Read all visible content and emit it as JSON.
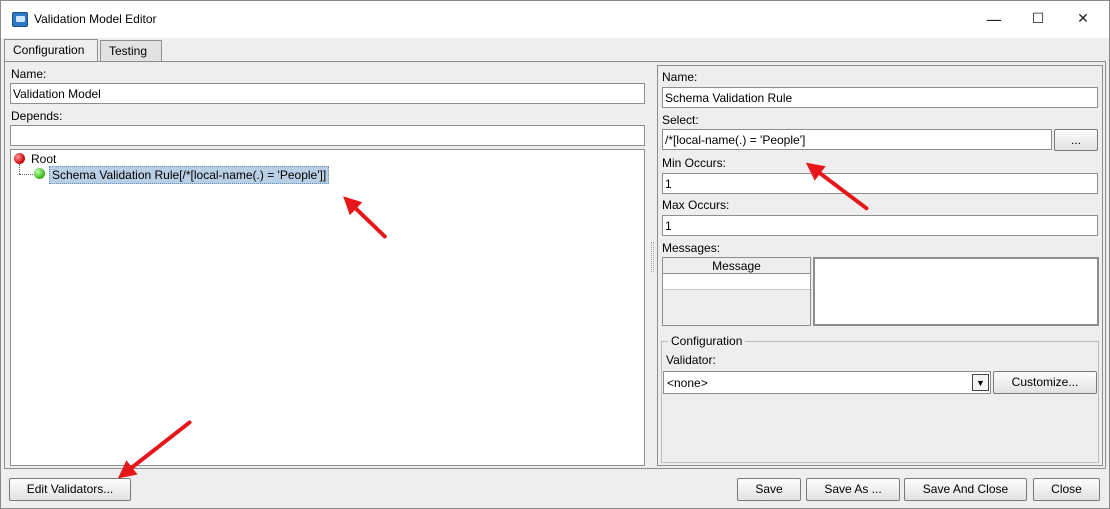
{
  "window": {
    "title": "Validation Model Editor",
    "controls": {
      "minimize": "—",
      "maximize": "☐",
      "close": "✕"
    }
  },
  "tabs": [
    {
      "label": "Configuration",
      "active": true
    },
    {
      "label": "Testing",
      "active": false
    }
  ],
  "left": {
    "name_label": "Name:",
    "name_value": "Validation Model",
    "depends_label": "Depends:",
    "depends_value": "",
    "tree": {
      "root": "Root",
      "child": "Schema Validation Rule[/*[local-name(.) = 'People']]"
    }
  },
  "right": {
    "name_label": "Name:",
    "name_value": "Schema Validation Rule",
    "select_label": "Select:",
    "select_value": "/*[local-name(.) = 'People']",
    "browse_label": "...",
    "min_label": "Min Occurs:",
    "min_value": "1",
    "max_label": "Max Occurs:",
    "max_value": "1",
    "messages_label": "Messages:",
    "messages_header": "Message",
    "config_title": "Configuration",
    "validator_label": "Validator:",
    "validator_value": "<none>",
    "customize_label": "Customize..."
  },
  "footer": {
    "edit_validators": "Edit Validators...",
    "save": "Save",
    "save_as": "Save As ...",
    "save_and_close": "Save And Close",
    "close": "Close"
  },
  "colors": {
    "annotation_arrow": "#e5171b",
    "selection": "#b8cfe5"
  }
}
